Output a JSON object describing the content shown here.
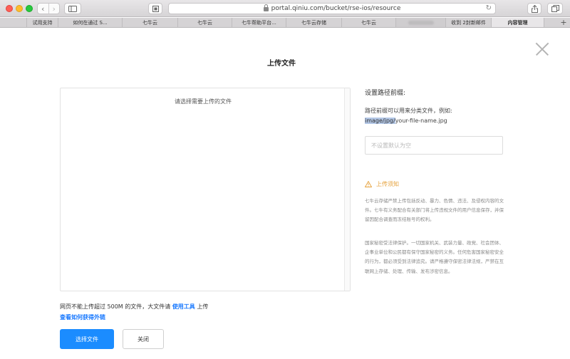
{
  "browser": {
    "url": "portal.qiniu.com/bucket/rse-ios/resource",
    "bookmarks": [
      {
        "label": "",
        "blurred": false
      },
      {
        "label": "试用支持",
        "blurred": false
      },
      {
        "label": "如何在通过 S...",
        "blurred": false
      },
      {
        "label": "七牛云",
        "blurred": false
      },
      {
        "label": "七牛云",
        "blurred": false
      },
      {
        "label": "七牛帮助平台...",
        "blurred": false
      },
      {
        "label": "七牛云存储",
        "blurred": false
      },
      {
        "label": "七牛云",
        "blurred": false
      },
      {
        "label": "",
        "blurred": true
      },
      {
        "label": "收到 2封新邮件",
        "blurred": false
      },
      {
        "label": "内容管理",
        "blurred": false,
        "active": true
      }
    ]
  },
  "dialog": {
    "title": "上传文件",
    "dropzone_hint": "请选择需要上传的文件",
    "prefix": {
      "title": "设置路径前缀:",
      "desc": "路径前缀可以用来分类文件，例如:",
      "example_highlight": "image/jpg/",
      "example_rest": "your-file-name.jpg",
      "placeholder": "不设置默认为空",
      "value": ""
    },
    "notice": {
      "title": "上传须知",
      "p1": "七牛云存储严禁上传包括反动、暴力、色情、违法、及侵权内容的文件。七牛有义务配合有关部门将上传违规文件的用户信息保存，并保留因配合调查而冻结账号的权利。",
      "p2": "国家秘密受法律保护。一切国家机关、武装力量、政党、社会团体、企事业单位和公民都有保守国家秘密的义务。任何危害国家秘密安全的行为，都必须受到法律追究。请严格遵守保密法律法规，严禁在互联网上存储、处理、传输、发布涉密信息。"
    },
    "limit_prefix": "网页不能上传超过 500M 的文件，大文件请 ",
    "limit_link": "使用工具",
    "limit_suffix": " 上传",
    "external_link": "查看如何获得外链",
    "select_button": "选择文件",
    "close_button": "关闭"
  },
  "colors": {
    "primary": "#1b8cff",
    "link": "#1677ff",
    "warning": "#e6a23c"
  }
}
